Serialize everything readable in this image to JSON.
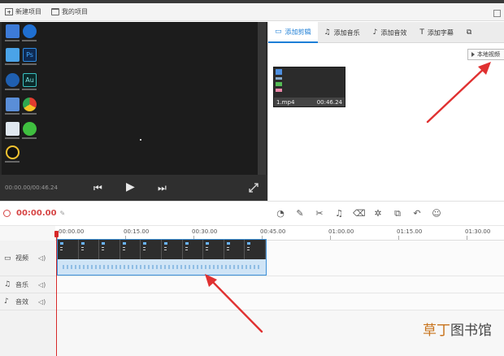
{
  "menubar": {
    "new_project": "新建项目",
    "my_projects": "我的项目"
  },
  "player": {
    "timecode": "00:00.00/00:46.24"
  },
  "panel": {
    "tabs": [
      {
        "label": "添加剪辑",
        "icon": "camera-icon",
        "active": true
      },
      {
        "label": "添加音乐",
        "icon": "music-note-icon"
      },
      {
        "label": "添加音效",
        "icon": "sound-effect-icon"
      },
      {
        "label": "添加字幕",
        "icon": "text-icon"
      }
    ],
    "local_video_button": "本地视频",
    "thumbnail": {
      "name": "1.mp4",
      "duration": "00:46.24"
    }
  },
  "toolbar": {
    "current_time": "00:00.00",
    "tools": [
      "speed-icon",
      "edit-icon",
      "scissors-icon",
      "bell-icon",
      "delete-icon",
      "magic-icon",
      "copy-icon",
      "undo-icon",
      "emoji-icon"
    ]
  },
  "timeline": {
    "ruler": [
      "00:00.00",
      "00:15.00",
      "00:30.00",
      "00:45.00",
      "01:00.00",
      "01:15.00",
      "01:30.00"
    ],
    "tracks": {
      "video": "视频",
      "music": "音乐",
      "sfx": "音效"
    }
  },
  "watermark": {
    "part1": "草丁",
    "part2": "图书馆"
  },
  "colors": {
    "accent": "#1c7ed6",
    "time_red": "#d64545",
    "arrow_red": "#e03131"
  }
}
